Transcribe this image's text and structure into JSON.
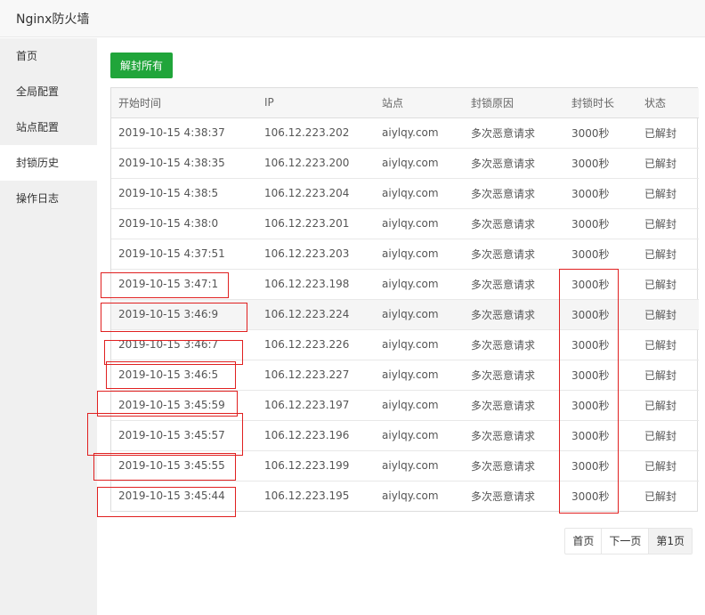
{
  "window": {
    "title": "Nginx防火墙"
  },
  "sidebar": {
    "items": [
      {
        "label": "首页",
        "active": false
      },
      {
        "label": "全局配置",
        "active": false
      },
      {
        "label": "站点配置",
        "active": false
      },
      {
        "label": "封锁历史",
        "active": true
      },
      {
        "label": "操作日志",
        "active": false
      }
    ]
  },
  "toolbar": {
    "unblock_all_label": "解封所有",
    "accent_color": "#20a53a"
  },
  "table": {
    "headers": [
      "开始时间",
      "IP",
      "站点",
      "封锁原因",
      "封锁时长",
      "状态"
    ],
    "rows": [
      [
        "2019-10-15 4:38:37",
        "106.12.223.202",
        "aiylqy.com",
        "多次恶意请求",
        "3000秒",
        "已解封"
      ],
      [
        "2019-10-15 4:38:35",
        "106.12.223.200",
        "aiylqy.com",
        "多次恶意请求",
        "3000秒",
        "已解封"
      ],
      [
        "2019-10-15 4:38:5",
        "106.12.223.204",
        "aiylqy.com",
        "多次恶意请求",
        "3000秒",
        "已解封"
      ],
      [
        "2019-10-15 4:38:0",
        "106.12.223.201",
        "aiylqy.com",
        "多次恶意请求",
        "3000秒",
        "已解封"
      ],
      [
        "2019-10-15 4:37:51",
        "106.12.223.203",
        "aiylqy.com",
        "多次恶意请求",
        "3000秒",
        "已解封"
      ],
      [
        "2019-10-15 3:47:1",
        "106.12.223.198",
        "aiylqy.com",
        "多次恶意请求",
        "3000秒",
        "已解封"
      ],
      [
        "2019-10-15 3:46:9",
        "106.12.223.224",
        "aiylqy.com",
        "多次恶意请求",
        "3000秒",
        "已解封"
      ],
      [
        "2019-10-15 3:46:7",
        "106.12.223.226",
        "aiylqy.com",
        "多次恶意请求",
        "3000秒",
        "已解封"
      ],
      [
        "2019-10-15 3:46:5",
        "106.12.223.227",
        "aiylqy.com",
        "多次恶意请求",
        "3000秒",
        "已解封"
      ],
      [
        "2019-10-15 3:45:59",
        "106.12.223.197",
        "aiylqy.com",
        "多次恶意请求",
        "3000秒",
        "已解封"
      ],
      [
        "2019-10-15 3:45:57",
        "106.12.223.196",
        "aiylqy.com",
        "多次恶意请求",
        "3000秒",
        "已解封"
      ],
      [
        "2019-10-15 3:45:55",
        "106.12.223.199",
        "aiylqy.com",
        "多次恶意请求",
        "3000秒",
        "已解封"
      ],
      [
        "2019-10-15 3:45:44",
        "106.12.223.195",
        "aiylqy.com",
        "多次恶意请求",
        "3000秒",
        "已解封"
      ]
    ],
    "highlighted_row_index": 6
  },
  "pagination": {
    "first_label": "首页",
    "next_label": "下一页",
    "current_label": "第1页"
  },
  "annotations": {
    "color": "#e02020"
  }
}
